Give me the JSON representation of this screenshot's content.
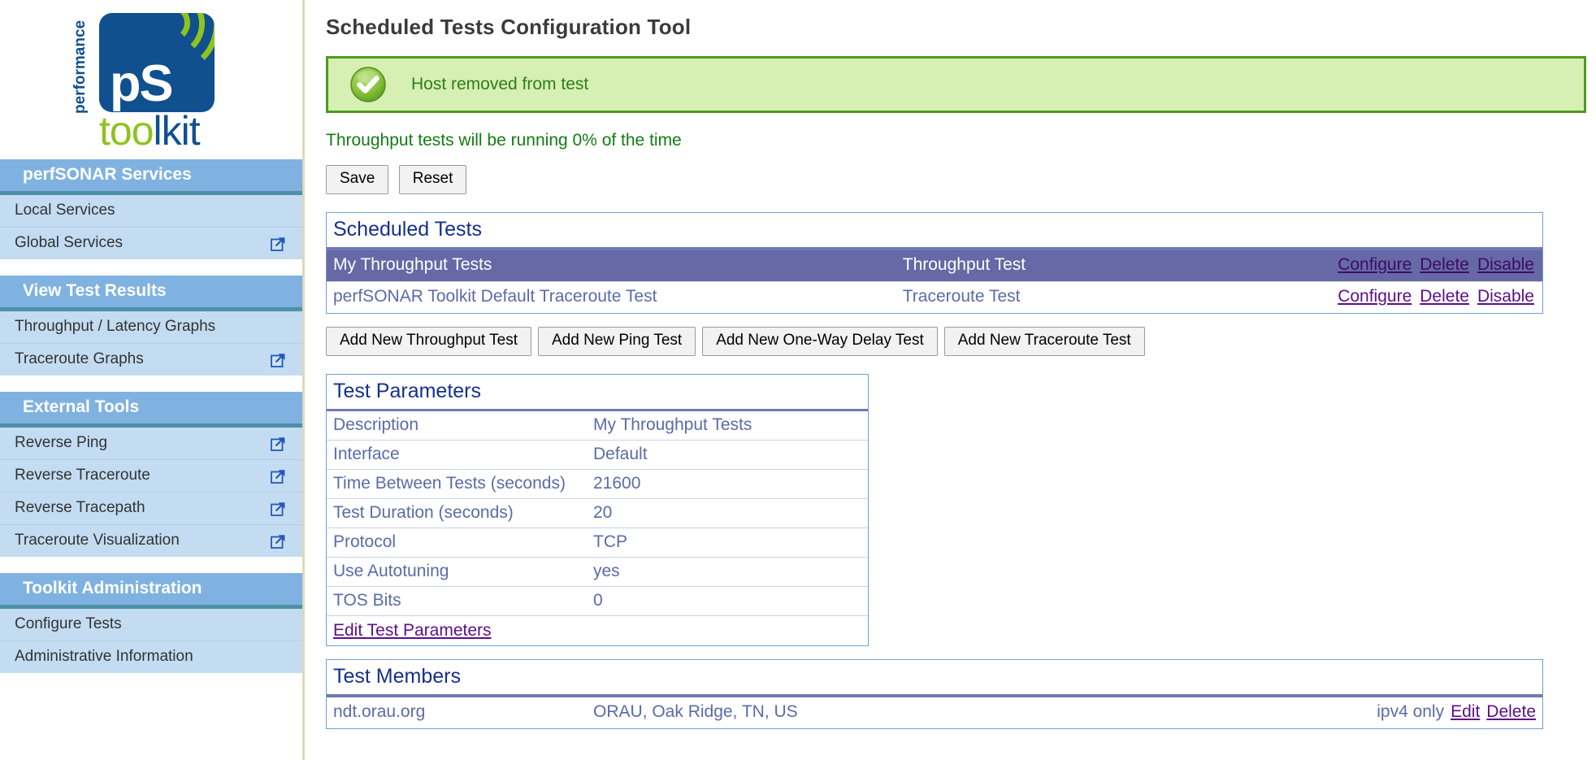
{
  "logo": {
    "vertical_text": "performance",
    "mark_text": "pS",
    "word_toolkit": "toolkit",
    "word_toolkit_green": "too",
    "word_toolkit_blue": "lkit"
  },
  "sidebar": {
    "groups": [
      {
        "header": "perfSONAR Services",
        "items": [
          {
            "label": "Local Services",
            "external": false
          },
          {
            "label": "Global Services",
            "external": true
          }
        ]
      },
      {
        "header": "View Test Results",
        "items": [
          {
            "label": "Throughput / Latency Graphs",
            "external": false
          },
          {
            "label": "Traceroute Graphs",
            "external": true
          }
        ]
      },
      {
        "header": "External Tools",
        "items": [
          {
            "label": "Reverse Ping",
            "external": true
          },
          {
            "label": "Reverse Traceroute",
            "external": true
          },
          {
            "label": "Reverse Tracepath",
            "external": true
          },
          {
            "label": "Traceroute Visualization",
            "external": true
          }
        ]
      },
      {
        "header": "Toolkit Administration",
        "items": [
          {
            "label": "Configure Tests",
            "external": false
          },
          {
            "label": "Administrative Information",
            "external": false
          }
        ]
      }
    ]
  },
  "main": {
    "page_title": "Scheduled Tests Configuration Tool",
    "alert": {
      "icon": "success-check-icon",
      "message": "Host removed from test",
      "bg_color": "#d6efb2",
      "border_color": "#4f9a21",
      "text_color": "#2f7d1c"
    },
    "status_line": "Throughput tests will be running 0% of the time",
    "buttons": {
      "save": "Save",
      "reset": "Reset"
    },
    "scheduled_tests": {
      "title": "Scheduled Tests",
      "rows": [
        {
          "name": "My Throughput Tests",
          "type": "Throughput Test",
          "actions": [
            "Configure",
            "Delete",
            "Disable"
          ],
          "selected": true
        },
        {
          "name": "perfSONAR Toolkit Default Traceroute Test",
          "type": "Traceroute Test",
          "actions": [
            "Configure",
            "Delete",
            "Disable"
          ],
          "selected": false
        }
      ]
    },
    "add_buttons": [
      "Add New Throughput Test",
      "Add New Ping Test",
      "Add New One-Way Delay Test",
      "Add New Traceroute Test"
    ],
    "test_parameters": {
      "title": "Test Parameters",
      "rows": [
        {
          "key": "Description",
          "value": "My Throughput Tests"
        },
        {
          "key": "Interface",
          "value": "Default"
        },
        {
          "key": "Time Between Tests (seconds)",
          "value": "21600"
        },
        {
          "key": "Test Duration (seconds)",
          "value": "20"
        },
        {
          "key": "Protocol",
          "value": "TCP"
        },
        {
          "key": "Use Autotuning",
          "value": "yes"
        },
        {
          "key": "TOS Bits",
          "value": "0"
        }
      ],
      "edit_link": "Edit Test Parameters"
    },
    "test_members": {
      "title": "Test Members",
      "rows": [
        {
          "host": "ndt.orau.org",
          "location": "ORAU, Oak Ridge, TN, US",
          "address_type": "ipv4 only",
          "actions": [
            "Edit",
            "Delete"
          ]
        }
      ]
    }
  },
  "colors": {
    "nav_header_bg": "#7fb2e0",
    "nav_header_rule": "#4f8fa8",
    "nav_item_bg": "#c3dcf2",
    "panel_border": "#6f9fd8",
    "panel_title": "#15308f",
    "selected_row_bg": "#6669a6",
    "link": "#5c0f8b",
    "table_text": "#5b6ba8",
    "logo_blue": "#10508f",
    "logo_green": "#8ec320",
    "sidebar_divider": "#ded9b6"
  }
}
